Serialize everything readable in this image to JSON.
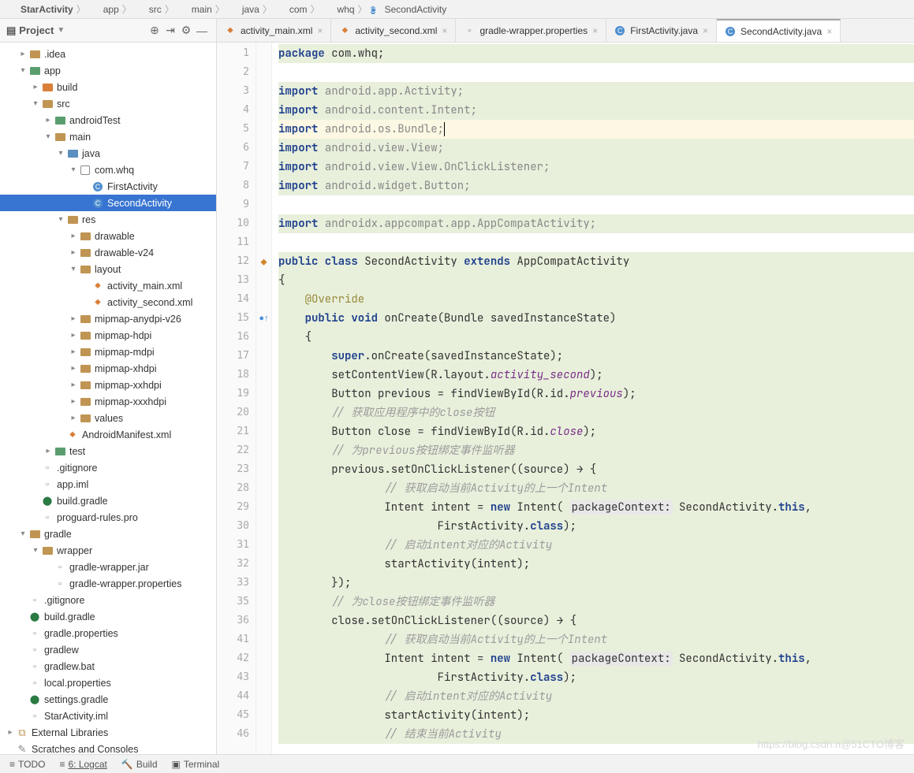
{
  "breadcrumb": [
    "StarActivity",
    "app",
    "src",
    "main",
    "java",
    "com",
    "whq",
    "SecondActivity"
  ],
  "breadcrumb_icons": [
    "folder",
    "module",
    "folder",
    "folder",
    "folder",
    "folder",
    "folder",
    "class"
  ],
  "sidebar": {
    "title": "Project",
    "toolbar_icons": [
      "target-icon",
      "collapse-icon",
      "gear-icon",
      "hide-icon"
    ]
  },
  "tree": [
    {
      "d": 1,
      "a": "r",
      "i": "folder",
      "l": ".idea"
    },
    {
      "d": 1,
      "a": "d",
      "i": "module",
      "l": "app"
    },
    {
      "d": 2,
      "a": "r",
      "i": "folder-o",
      "l": "build"
    },
    {
      "d": 2,
      "a": "d",
      "i": "folder",
      "l": "src"
    },
    {
      "d": 3,
      "a": "r",
      "i": "folder-g",
      "l": "androidTest"
    },
    {
      "d": 3,
      "a": "d",
      "i": "folder",
      "l": "main"
    },
    {
      "d": 4,
      "a": "d",
      "i": "folder-b",
      "l": "java"
    },
    {
      "d": 5,
      "a": "d",
      "i": "pkg",
      "l": "com.whq"
    },
    {
      "d": 6,
      "a": "",
      "i": "class",
      "l": "FirstActivity"
    },
    {
      "d": 6,
      "a": "",
      "i": "class",
      "l": "SecondActivity",
      "sel": true
    },
    {
      "d": 4,
      "a": "d",
      "i": "folder-r",
      "l": "res"
    },
    {
      "d": 5,
      "a": "r",
      "i": "folder",
      "l": "drawable"
    },
    {
      "d": 5,
      "a": "r",
      "i": "folder",
      "l": "drawable-v24"
    },
    {
      "d": 5,
      "a": "d",
      "i": "folder",
      "l": "layout"
    },
    {
      "d": 6,
      "a": "",
      "i": "xml",
      "l": "activity_main.xml"
    },
    {
      "d": 6,
      "a": "",
      "i": "xml",
      "l": "activity_second.xml"
    },
    {
      "d": 5,
      "a": "r",
      "i": "folder",
      "l": "mipmap-anydpi-v26"
    },
    {
      "d": 5,
      "a": "r",
      "i": "folder",
      "l": "mipmap-hdpi"
    },
    {
      "d": 5,
      "a": "r",
      "i": "folder",
      "l": "mipmap-mdpi"
    },
    {
      "d": 5,
      "a": "r",
      "i": "folder",
      "l": "mipmap-xhdpi"
    },
    {
      "d": 5,
      "a": "r",
      "i": "folder",
      "l": "mipmap-xxhdpi"
    },
    {
      "d": 5,
      "a": "r",
      "i": "folder",
      "l": "mipmap-xxxhdpi"
    },
    {
      "d": 5,
      "a": "r",
      "i": "folder",
      "l": "values"
    },
    {
      "d": 4,
      "a": "",
      "i": "xml",
      "l": "AndroidManifest.xml"
    },
    {
      "d": 3,
      "a": "r",
      "i": "folder-g",
      "l": "test"
    },
    {
      "d": 2,
      "a": "",
      "i": "txt",
      "l": ".gitignore"
    },
    {
      "d": 2,
      "a": "",
      "i": "txt",
      "l": "app.iml"
    },
    {
      "d": 2,
      "a": "",
      "i": "gradle",
      "l": "build.gradle"
    },
    {
      "d": 2,
      "a": "",
      "i": "txt",
      "l": "proguard-rules.pro"
    },
    {
      "d": 1,
      "a": "d",
      "i": "folder",
      "l": "gradle"
    },
    {
      "d": 2,
      "a": "d",
      "i": "folder",
      "l": "wrapper"
    },
    {
      "d": 3,
      "a": "",
      "i": "txt",
      "l": "gradle-wrapper.jar"
    },
    {
      "d": 3,
      "a": "",
      "i": "txt",
      "l": "gradle-wrapper.properties"
    },
    {
      "d": 1,
      "a": "",
      "i": "txt",
      "l": ".gitignore"
    },
    {
      "d": 1,
      "a": "",
      "i": "gradle",
      "l": "build.gradle"
    },
    {
      "d": 1,
      "a": "",
      "i": "txt",
      "l": "gradle.properties"
    },
    {
      "d": 1,
      "a": "",
      "i": "txt",
      "l": "gradlew"
    },
    {
      "d": 1,
      "a": "",
      "i": "txt",
      "l": "gradlew.bat"
    },
    {
      "d": 1,
      "a": "",
      "i": "txt",
      "l": "local.properties"
    },
    {
      "d": 1,
      "a": "",
      "i": "gradle",
      "l": "settings.gradle"
    },
    {
      "d": 1,
      "a": "",
      "i": "txt",
      "l": "StarActivity.iml"
    },
    {
      "d": 0,
      "a": "r",
      "i": "lib",
      "l": "External Libraries"
    },
    {
      "d": 0,
      "a": "",
      "i": "scratch",
      "l": "Scratches and Consoles"
    }
  ],
  "tabs": [
    {
      "i": "xml",
      "l": "activity_main.xml"
    },
    {
      "i": "xml",
      "l": "activity_second.xml"
    },
    {
      "i": "txt",
      "l": "gradle-wrapper.properties"
    },
    {
      "i": "class",
      "l": "FirstActivity.java"
    },
    {
      "i": "class",
      "l": "SecondActivity.java",
      "active": true
    }
  ],
  "code_lines": [
    {
      "n": 1,
      "h": "<span class='kw'>package</span> com.whq;"
    },
    {
      "n": 2,
      "h": "",
      "plain": true
    },
    {
      "n": 3,
      "h": "<span class='kw'>import</span> <span class='pkgn'>android.app.Activity;</span>"
    },
    {
      "n": 4,
      "h": "<span class='kw'>import</span> <span class='pkgn'>android.content.Intent;</span>"
    },
    {
      "n": 5,
      "h": "<span class='kw'>import</span> <span class='pkgn'>android.os.Bundle;</span><span class='caret-bar'></span>",
      "caret": true
    },
    {
      "n": 6,
      "h": "<span class='kw'>import</span> <span class='pkgn'>android.view.View;</span>"
    },
    {
      "n": 7,
      "h": "<span class='kw'>import</span> <span class='pkgn'>android.view.View.OnClickListener;</span>"
    },
    {
      "n": 8,
      "h": "<span class='kw'>import</span> <span class='pkgn'>android.widget.Button;</span>"
    },
    {
      "n": 9,
      "h": "",
      "plain": true
    },
    {
      "n": 10,
      "h": "<span class='kw'>import</span> <span class='pkgn'>androidx.appcompat.app.AppCompatActivity;</span>"
    },
    {
      "n": 11,
      "h": "",
      "plain": true
    },
    {
      "n": 12,
      "h": "<span class='kw'>public class</span> SecondActivity <span class='kw'>extends</span> AppCompatActivity",
      "mark": "ov"
    },
    {
      "n": 13,
      "h": "{"
    },
    {
      "n": 14,
      "h": "    <span class='ann'>@Override</span>"
    },
    {
      "n": 15,
      "h": "    <span class='kw'>public void</span> onCreate(Bundle savedInstanceState)",
      "mark": "impl"
    },
    {
      "n": 16,
      "h": "    {"
    },
    {
      "n": 17,
      "h": "        <span class='kw'>super</span>.onCreate(savedInstanceState);"
    },
    {
      "n": 18,
      "h": "        setContentView(R.layout.<span class='field'>activity_second</span>);"
    },
    {
      "n": 19,
      "h": "        Button previous = findViewById(R.id.<span class='field'>previous</span>);"
    },
    {
      "n": 20,
      "h": "        <span class='com'>// 获取应用程序中的close按钮</span>"
    },
    {
      "n": 21,
      "h": "        Button close = findViewById(R.id.<span class='field'>close</span>);"
    },
    {
      "n": 22,
      "h": "        <span class='com'>// 为previous按钮绑定事件监听器</span>"
    },
    {
      "n": 23,
      "h": "        previous.setOnClickListener((source) → {"
    },
    {
      "n": 28,
      "h": "                <span class='com'>// 获取启动当前Activity的上一个Intent</span>"
    },
    {
      "n": 29,
      "h": "                Intent intent = <span class='kw'>new</span> Intent( <span class='paramh'>packageContext:</span> SecondActivity.<span class='kw'>this</span>,"
    },
    {
      "n": 30,
      "h": "                        FirstActivity.<span class='kw'>class</span>);"
    },
    {
      "n": 31,
      "h": "                <span class='com'>// 启动intent对应的Activity</span>"
    },
    {
      "n": 32,
      "h": "                startActivity(intent);"
    },
    {
      "n": 33,
      "h": "        });"
    },
    {
      "n": 35,
      "h": "        <span class='com'>// 为close按钮绑定事件监听器</span>"
    },
    {
      "n": 36,
      "h": "        close.setOnClickListener((source) → {"
    },
    {
      "n": 41,
      "h": "                <span class='com'>// 获取启动当前Activity的上一个Intent</span>"
    },
    {
      "n": 42,
      "h": "                Intent intent = <span class='kw'>new</span> Intent( <span class='paramh'>packageContext:</span> SecondActivity.<span class='kw'>this</span>,"
    },
    {
      "n": 43,
      "h": "                        FirstActivity.<span class='kw'>class</span>);"
    },
    {
      "n": 44,
      "h": "                <span class='com'>// 启动intent对应的Activity</span>"
    },
    {
      "n": 45,
      "h": "                startActivity(intent);"
    },
    {
      "n": 46,
      "h": "                <span class='com'>// 结束当前Activity</span>"
    }
  ],
  "bottom": {
    "todo": "TODO",
    "logcat": "6: Logcat",
    "build": "Build",
    "terminal": "Terminal"
  },
  "watermark": "https://blog.csdn.n@51CTO博客"
}
